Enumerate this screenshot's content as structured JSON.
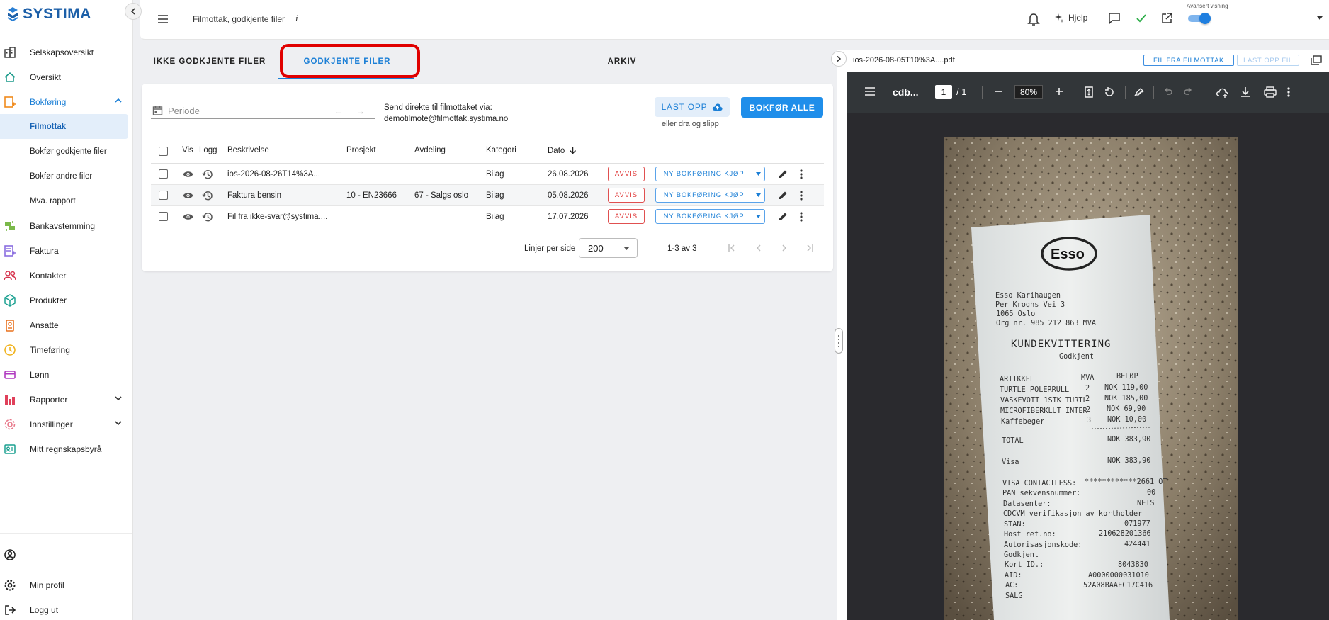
{
  "app": {
    "logo": "SYSTIMA"
  },
  "sidebar": {
    "items": [
      {
        "label": "Selskapsoversikt",
        "icon": "building-icon"
      },
      {
        "label": "Oversikt",
        "icon": "home-icon"
      },
      {
        "label": "Bokføring",
        "icon": "ledger-icon",
        "expanded": true
      },
      {
        "label": "Filmottak",
        "sub": true,
        "active": true
      },
      {
        "label": "Bokfør godkjente filer",
        "sub": true
      },
      {
        "label": "Bokfør andre filer",
        "sub": true
      },
      {
        "label": "Mva. rapport",
        "sub": true
      },
      {
        "label": "Bankavstemming",
        "icon": "bank-icon"
      },
      {
        "label": "Faktura",
        "icon": "invoice-icon"
      },
      {
        "label": "Kontakter",
        "icon": "contacts-icon"
      },
      {
        "label": "Produkter",
        "icon": "product-icon"
      },
      {
        "label": "Ansatte",
        "icon": "employee-icon"
      },
      {
        "label": "Timeføring",
        "icon": "clock-icon"
      },
      {
        "label": "Lønn",
        "icon": "card-icon"
      },
      {
        "label": "Rapporter",
        "icon": "report-icon",
        "expandable": true
      },
      {
        "label": "Innstillinger",
        "icon": "settings-icon",
        "expandable": true
      },
      {
        "label": "Mitt regnskapsbyrå",
        "icon": "agency-icon"
      }
    ],
    "bottom": {
      "profile": "Min profil",
      "logout": "Logg ut"
    }
  },
  "header": {
    "title": "Filmottak, godkjente filer",
    "info": "i",
    "help": "Hjelp",
    "advanced_label": "Avansert visning",
    "advanced_on": true
  },
  "tabs": [
    {
      "label": "IKKE GODKJENTE FILER"
    },
    {
      "label": "GODKJENTE FILER",
      "active": true
    },
    {
      "label": "ARKIV"
    }
  ],
  "toolbar": {
    "periode_placeholder": "Periode",
    "send_line1": "Send direkte til filmottaket via:",
    "send_line2": "demotilmote@filmottak.systima.no",
    "upload_label": "LAST OPP",
    "drag_hint": "eller dra og slipp",
    "post_all_label": "BOKFØR ALLE"
  },
  "table": {
    "columns": [
      "Vis",
      "Logg",
      "Beskrivelse",
      "Prosjekt",
      "Avdeling",
      "Kategori",
      "Dato"
    ],
    "rows": [
      {
        "beskrivelse": "ios-2026-08-26T14%3A...",
        "prosjekt": "",
        "avdeling": "",
        "kategori": "Bilag",
        "dato": "26.08.2026"
      },
      {
        "beskrivelse": "Faktura bensin",
        "prosjekt": "10 - EN23666",
        "avdeling": "67 - Salgs oslo",
        "kategori": "Bilag",
        "dato": "05.08.2026"
      },
      {
        "beskrivelse": "Fil fra ikke-svar@systima....",
        "prosjekt": "",
        "avdeling": "",
        "kategori": "Bilag",
        "dato": "17.07.2026"
      }
    ],
    "reject_label": "AVVIS",
    "new_entry_label": "NY BOKFØRING KJØP",
    "pagination": {
      "rows_per_page_label": "Linjer per side",
      "rows_per_page": "200",
      "range": "1-3 av 3"
    }
  },
  "preview": {
    "filename": "ios-2026-08-05T10%3A....pdf",
    "btn_from_inbox": "FIL FRA FILMOTTAK",
    "btn_upload_file": "LAST OPP FIL",
    "viewer": {
      "doc_name": "cdb...",
      "page": "1",
      "page_total": "/ 1",
      "zoom": "80%"
    },
    "receipt": {
      "brand": "Esso",
      "address": [
        "Esso Karihaugen",
        "Per Kroghs Vei 3",
        "1065 Oslo",
        "Org nr. 985 212 863 MVA"
      ],
      "heading": "KUNDEKVITTERING",
      "subheading": "Godkjent",
      "col_item": "ARTIKKEL",
      "col_vat": "MVA",
      "col_amount": "BELØP",
      "lines": [
        {
          "item": "TURTLE POLERRULL",
          "vat": "2",
          "amount": "NOK 119,00"
        },
        {
          "item": "VASKEVOTT 1STK TURTL",
          "vat": "2",
          "amount": "NOK 185,00"
        },
        {
          "item": "MICROFIBERKLUT INTER",
          "vat": "2",
          "amount": "NOK 69,90"
        },
        {
          "item": "Kaffebeger",
          "vat": "3",
          "amount": "NOK 10,00"
        }
      ],
      "total_label": "TOTAL",
      "total": "NOK 383,90",
      "visa_label": "Visa",
      "visa": "NOK 383,90",
      "details": [
        {
          "k": "VISA CONTACTLESS:",
          "v": "************2661 OT"
        },
        {
          "k": "PAN sekvensnummer:",
          "v": "00"
        },
        {
          "k": "Datasenter:",
          "v": "NETS"
        },
        {
          "k": "CDCVM verifikasjon av kortholder",
          "v": ""
        },
        {
          "k": "STAN:",
          "v": "071977"
        },
        {
          "k": "Host ref.no:",
          "v": "210628201366"
        },
        {
          "k": "Autorisasjonskode:",
          "v": "424441"
        },
        {
          "k": "Godkjent",
          "v": ""
        },
        {
          "k": "Kort ID.:",
          "v": "8043830"
        },
        {
          "k": "AID:",
          "v": "A0000000031010"
        },
        {
          "k": "AC:",
          "v": "52A08BAAEC17C416"
        },
        {
          "k": "SALG",
          "v": ""
        }
      ]
    }
  }
}
